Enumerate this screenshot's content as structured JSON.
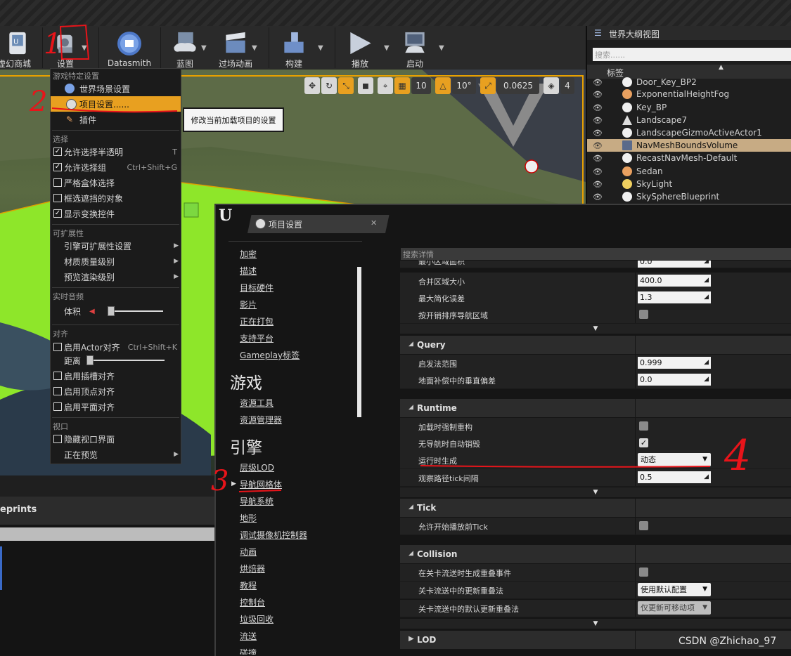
{
  "toolbar": {
    "buttons": [
      {
        "label": "虚幻商城",
        "icon": "marketplace-icon"
      },
      {
        "label": "设置",
        "icon": "settings-gear-icon"
      },
      {
        "label": "Datasmith",
        "icon": "datasmith-icon"
      },
      {
        "label": "蓝图",
        "icon": "blueprint-gamepad-icon"
      },
      {
        "label": "过场动画",
        "icon": "clapperboard-icon"
      },
      {
        "label": "构建",
        "icon": "build-blocks-icon"
      },
      {
        "label": "播放",
        "icon": "play-triangle-icon"
      },
      {
        "label": "启动",
        "icon": "launch-monitor-icon"
      }
    ]
  },
  "viewport_toolbar": {
    "grid_snap": "10",
    "rotation_snap": "10°",
    "scale_snap": "0.0625",
    "camera_speed": "4"
  },
  "outliner": {
    "title": "世界大纲视图",
    "search_placeholder": "搜索......",
    "column_label": "标签",
    "items": [
      {
        "label": "Door_Key_BP2"
      },
      {
        "label": "ExponentialHeightFog"
      },
      {
        "label": "Key_BP"
      },
      {
        "label": "Landscape7"
      },
      {
        "label": "LandscapeGizmoActiveActor1"
      },
      {
        "label": "NavMeshBoundsVolume",
        "selected": true
      },
      {
        "label": "RecastNavMesh-Default"
      },
      {
        "label": "Sedan"
      },
      {
        "label": "SkyLight"
      },
      {
        "label": "SkySphereBlueprint"
      }
    ]
  },
  "settings_menu": {
    "sec_game": "游戏特定设置",
    "world_settings": "世界场景设置",
    "project_settings": "项目设置......",
    "plugins": "插件",
    "sec_select": "选择",
    "allow_translucent": "允许选择半透明",
    "allow_translucent_sc": "T",
    "allow_group": "允许选择组",
    "allow_group_sc": "Ctrl+Shift+G",
    "strict_box": "严格盒体选择",
    "box_occluded": "框选遮挡的对象",
    "show_transform": "显示变换控件",
    "sec_ext": "可扩展性",
    "engine_scal": "引擎可扩展性设置",
    "material_quality": "材质质量级别",
    "preview_render": "预览渲染级别",
    "sec_audio": "实时音频",
    "volume": "体积",
    "sec_snap": "对齐",
    "actor_snap": "启用Actor对齐",
    "actor_snap_sc": "Ctrl+Shift+K",
    "distance": "距离",
    "socket_snap": "启用插槽对齐",
    "vertex_snap": "启用顶点对齐",
    "plane_snap": "启用平面对齐",
    "sec_view": "视口",
    "hide_viewport_ui": "隐藏视口界面",
    "previewing": "正在预览"
  },
  "tooltip": "修改当前加载项目的设置",
  "bottom_left": {
    "panel_title": "eprints"
  },
  "project_settings": {
    "tab_title": "项目设置",
    "search_placeholder": "搜索详情",
    "nav_top": [
      "加密",
      "描述",
      "目标硬件",
      "影片",
      "正在打包",
      "支持平台",
      "Gameplay标签"
    ],
    "game_heading": "游戏",
    "nav_game": [
      "资源工具",
      "资源管理器"
    ],
    "engine_heading": "引擎",
    "nav_engine": [
      "层级LOD",
      "导航网格体",
      "导航系统",
      "地形",
      "调试摄像机控制器",
      "动画",
      "烘焙器",
      "教程",
      "控制台",
      "垃圾回收",
      "流送",
      "碰撞"
    ],
    "rows_top": [
      {
        "name": "最小区域面积",
        "value": "0.0"
      },
      {
        "name": "合并区域大小",
        "value": "400.0"
      },
      {
        "name": "最大简化误差",
        "value": "1.3"
      },
      {
        "name": "按开销排序导航区域"
      }
    ],
    "query": {
      "title": "Query",
      "rows": [
        {
          "name": "启发法范围",
          "value": "0.999"
        },
        {
          "name": "地面补偿中的垂直偏差",
          "value": "0.0"
        }
      ]
    },
    "runtime": {
      "title": "Runtime",
      "rows": [
        {
          "name": "加载时强制重构"
        },
        {
          "name": "无导航时自动销毁"
        },
        {
          "name": "运行时生成",
          "value": "动态"
        },
        {
          "name": "观察路径tick间隔",
          "value": "0.5"
        }
      ]
    },
    "tick": {
      "title": "Tick",
      "rows": [
        {
          "name": "允许开始播放前Tick"
        }
      ]
    },
    "collision": {
      "title": "Collision",
      "rows": [
        {
          "name": "在关卡流送时生成重叠事件"
        },
        {
          "name": "关卡流送中的更新重叠法",
          "value": "使用默认配置"
        },
        {
          "name": "关卡流送中的默认更新重叠法",
          "value": "仅更新可移动项"
        }
      ]
    },
    "lod": {
      "title": "LOD"
    }
  },
  "annotations": {
    "n1": "1",
    "n2": "2",
    "n3": "3",
    "n4": "4"
  },
  "watermark": "CSDN @Zhichao_97",
  "colors": {
    "accent_orange": "#e8a020",
    "selection_tan": "#c7ab84",
    "annotation_red": "#e8141a",
    "viewport_border": "#e8a000"
  }
}
